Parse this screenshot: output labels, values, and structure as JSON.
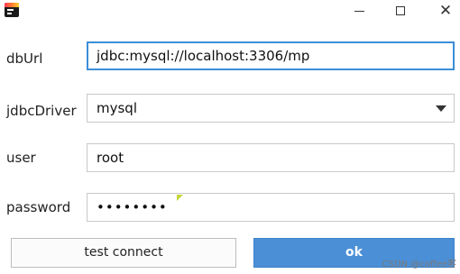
{
  "window": {
    "app_icon": "jetbrains-app-icon",
    "controls": {
      "minimize_icon": "minimize-icon",
      "maximize_icon": "maximize-icon",
      "close_icon": "close-icon",
      "close_glyph": "✕"
    }
  },
  "form": {
    "dbUrl": {
      "label": "dbUrl",
      "value": "jdbc:mysql://localhost:3306/mp"
    },
    "jdbcDriver": {
      "label": "jdbcDriver",
      "value": "mysql"
    },
    "user": {
      "label": "user",
      "value": "root"
    },
    "password": {
      "label": "password",
      "value": "••••••••"
    }
  },
  "buttons": {
    "test_connect": "test connect",
    "ok": "ok"
  },
  "watermark": "CSDN @coffee客",
  "colors": {
    "accent": "#4b8fd6",
    "focus_border": "#3b8ed8"
  }
}
